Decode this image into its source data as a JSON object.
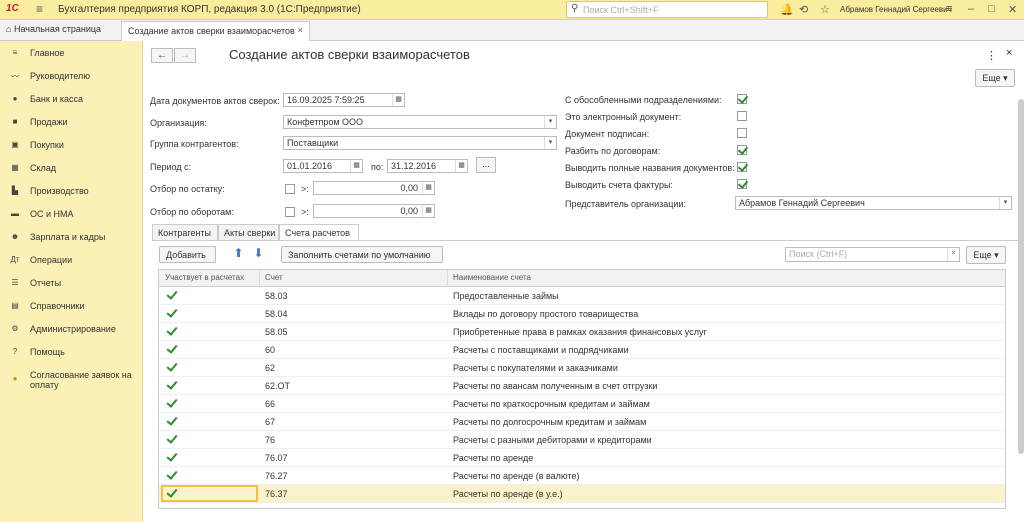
{
  "titlebar": {
    "logo": "1С",
    "menu_icon": "menu-icon",
    "title": "Бухгалтерия предприятия КОРП, редакция 3.0  (1С:Предприятие)",
    "search_placeholder": "Поиск Ctrl+Shift+F",
    "user": "Абрамов Геннадий Сергеевич"
  },
  "tabs": {
    "home": "Начальная страница",
    "active": "Создание актов сверки взаиморасчетов"
  },
  "sidebar": {
    "items": [
      {
        "label": "Главное",
        "icon": "menu-icon"
      },
      {
        "label": "Руководителю",
        "icon": "chart-icon"
      },
      {
        "label": "Банк и касса",
        "icon": "bank-icon"
      },
      {
        "label": "Продажи",
        "icon": "bag-icon"
      },
      {
        "label": "Покупки",
        "icon": "cart-icon"
      },
      {
        "label": "Склад",
        "icon": "warehouse-icon"
      },
      {
        "label": "Производство",
        "icon": "factory-icon"
      },
      {
        "label": "ОС и НМА",
        "icon": "truck-icon"
      },
      {
        "label": "Зарплата и кадры",
        "icon": "people-icon"
      },
      {
        "label": "Операции",
        "icon": "operations-icon"
      },
      {
        "label": "Отчеты",
        "icon": "reports-icon"
      },
      {
        "label": "Справочники",
        "icon": "book-icon"
      },
      {
        "label": "Администрирование",
        "icon": "gear-icon"
      },
      {
        "label": "Помощь",
        "icon": "help-icon"
      },
      {
        "label": "Согласование заявок на",
        "label2": "оплату",
        "icon": "coin-icon"
      }
    ]
  },
  "form": {
    "title": "Создание актов сверки взаиморасчетов",
    "more_label": "Еще",
    "date_label": "Дата документов актов сверок:",
    "date_value": "16.09.2025  7:59:25",
    "org_label": "Организация:",
    "org_value": "Конфетпром ООО",
    "group_label": "Группа контрагентов:",
    "group_value": "Поставщики",
    "period_label": "Период с:",
    "period_from": "01.01.2016",
    "period_to_label": "по:",
    "period_to": "31.12.2016",
    "dots": "...",
    "balance_label": "Отбор по остатку:",
    "balance_op": ">:",
    "balance_value": "0,00",
    "turnover_label": "Отбор по оборотам:",
    "turnover_op": ">:",
    "turnover_value": "0,00",
    "checks": [
      {
        "label": "С обособленными подразделениями:",
        "checked": true
      },
      {
        "label": "Это электронный документ:",
        "checked": false
      },
      {
        "label": "Документ подписан:",
        "checked": false
      },
      {
        "label": "Разбить по договорам:",
        "checked": true
      },
      {
        "label": "Выводить полные названия документов:",
        "checked": true
      },
      {
        "label": "Выводить счета фактуры:",
        "checked": true
      }
    ],
    "rep_label": "Представитель организации:",
    "rep_value": "Абрамов Геннадий Сергеевич"
  },
  "subtabs": [
    "Контрагенты",
    "Акты сверки",
    "Счета расчетов"
  ],
  "toolbar": {
    "add_label": "Добавить",
    "fill_label": "Заполнить счетами по умолчанию",
    "search_placeholder": "Поиск (Ctrl+F)",
    "more_label": "Еще"
  },
  "table": {
    "headers": [
      "Участвует в расчетах",
      "Счет",
      "Наименование счета"
    ],
    "rows": [
      {
        "account": "58.03",
        "name": "Предоставленные займы"
      },
      {
        "account": "58.04",
        "name": "Вклады по договору простого товарищества"
      },
      {
        "account": "58.05",
        "name": "Приобретенные права в рамках оказания финансовых услуг"
      },
      {
        "account": "60",
        "name": "Расчеты с поставщиками и подрядчиками"
      },
      {
        "account": "62",
        "name": "Расчеты с покупателями и заказчиками"
      },
      {
        "account": "62.ОТ",
        "name": "Расчеты по авансам полученным в счет отгрузки"
      },
      {
        "account": "66",
        "name": "Расчеты по краткосрочным кредитам и займам"
      },
      {
        "account": "67",
        "name": "Расчеты по долгосрочным кредитам и займам"
      },
      {
        "account": "76",
        "name": "Расчеты с разными дебиторами и кредиторами"
      },
      {
        "account": "76.07",
        "name": "Расчеты по аренде"
      },
      {
        "account": "76.27",
        "name": "Расчеты по аренде (в валюте)"
      },
      {
        "account": "76.37",
        "name": "Расчеты по аренде (в у.е.)"
      }
    ]
  }
}
